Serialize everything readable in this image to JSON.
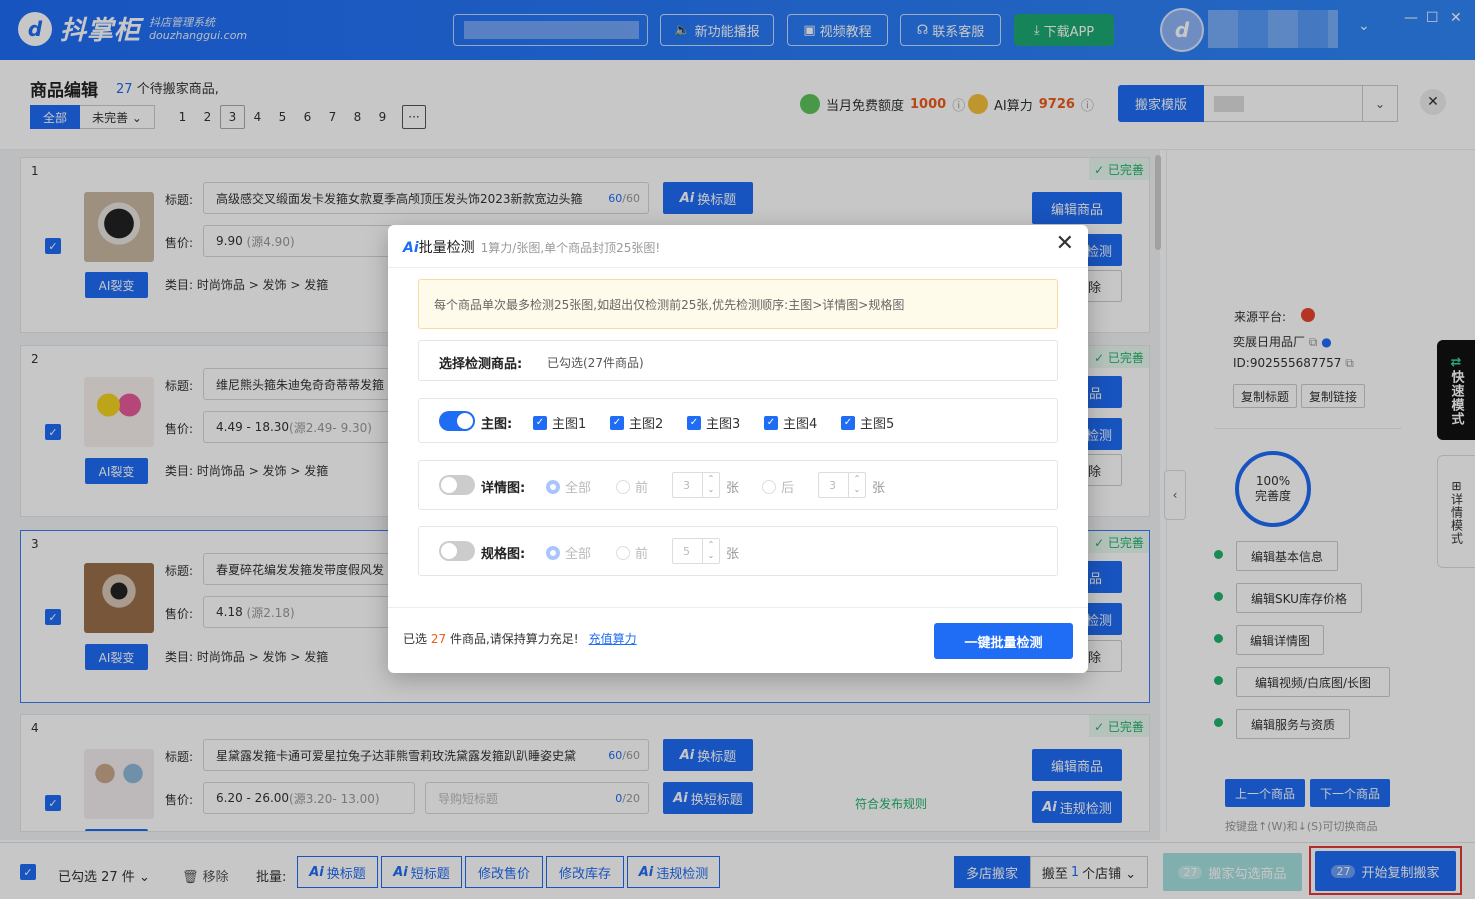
{
  "app": {
    "logo_mark": "d",
    "name": "抖掌柜",
    "subtitle_cn": "抖店管理系统",
    "subtitle_en": "douzhanggui.com"
  },
  "topbar": {
    "buttons": [
      {
        "label": "新功能播报",
        "icon": "megaphone-icon"
      },
      {
        "label": "视频教程",
        "icon": "video-icon"
      },
      {
        "label": "联系客服",
        "icon": "headset-icon"
      },
      {
        "label": "下载APP",
        "icon": "download-icon"
      }
    ],
    "avatar_mark": "d",
    "window": {
      "minimize": "—",
      "maximize": "☐",
      "close": "✕",
      "dropdown": "⌄"
    }
  },
  "header": {
    "title": "商品编辑",
    "count_num": "27",
    "count_text": "个待搬家商品,",
    "filter_all": "全部",
    "filter_incomplete": "未完善 ⌄",
    "pages": [
      "1",
      "2",
      "3",
      "4",
      "5",
      "6",
      "7",
      "8",
      "9"
    ],
    "current_page": "3",
    "more_pages": "···",
    "free_quota_label": "当月免费额度",
    "free_quota_value": "1000",
    "ai_power_label": "AI算力",
    "ai_power_value": "9726",
    "template_label": "搬家模版"
  },
  "products": [
    {
      "index": "1",
      "status": "✓ 已完善",
      "title_label": "标题:",
      "title": "高级感交叉缎面发卡发箍女款夏季高颅顶压发头饰2023新款宽边头箍",
      "title_count": "60",
      "title_max": "/60",
      "price_label": "售价:",
      "price": "9.90",
      "price_src": "(源4.90)",
      "category_label": "类目:",
      "category": "时尚饰品 > 发饰 > 发箍",
      "ai_split": "AI裂变",
      "ai_title": "换标题",
      "edit": "编辑商品",
      "check": "检测",
      "remove": "除"
    },
    {
      "index": "2",
      "status": "✓ 已完善",
      "title_label": "标题:",
      "title": "维尼熊头箍朱迪兔奇奇蒂蒂发箍",
      "price_label": "售价:",
      "price": "4.49 - 18.30",
      "price_src": "(源2.49- 9.30)",
      "category_label": "类目:",
      "category": "时尚饰品 > 发饰 > 发箍",
      "ai_split": "AI裂变",
      "edit": "品",
      "check": "检测",
      "remove": "除"
    },
    {
      "index": "3",
      "status": "✓ 已完善",
      "title_label": "标题:",
      "title": "春夏碎花编发发箍发带度假风发",
      "price_label": "售价:",
      "price": "4.18",
      "price_src": "(源2.18)",
      "category_label": "类目:",
      "category": "时尚饰品 > 发饰 > 发箍",
      "ai_split": "AI裂变",
      "edit": "品",
      "check": "检测",
      "remove": "除"
    },
    {
      "index": "4",
      "status": "✓ 已完善",
      "title_label": "标题:",
      "title": "星黛露发箍卡通可爱星拉兔子达菲熊雪莉玫洗黛露发箍趴趴睡姿史黛",
      "title_count": "60",
      "title_max": "/60",
      "price_label": "售价:",
      "price": "6.20 - 26.00",
      "price_src": "(源3.20- 13.00)",
      "short_title_placeholder": "导购短标题",
      "short_count": "0",
      "short_max": "/20",
      "ai_title": "换标题",
      "ai_short": "换短标题",
      "edit": "编辑商品",
      "check": "违规检测",
      "rule": "符合发布规则"
    }
  ],
  "side": {
    "source_label": "来源平台:",
    "shop": "奕展日用品厂",
    "id": "ID:902555687757",
    "copy_title": "复制标题",
    "copy_link": "复制链接",
    "completion": "100%",
    "completion_label": "完善度",
    "edit_items": [
      "编辑基本信息",
      "编辑SKU库存价格",
      "编辑详情图",
      "编辑视频/白底图/长图",
      "编辑服务与资质"
    ],
    "prev": "上一个商品",
    "next": "下一个商品",
    "hint": "按键盘↑(W)和↓(S)可切换商品",
    "mode_fast": "快速模式",
    "mode_detail": "详情模式"
  },
  "bottom": {
    "selected": "已勾选 27 件 ⌄",
    "remove": "移除",
    "batch": "批量:",
    "actions": [
      "换标题",
      "短标题",
      "修改售价",
      "修改库存",
      "违规检测"
    ],
    "multi_shop": "多店搬家",
    "move_to_prefix": "搬至",
    "move_to_num": "1",
    "move_to_suffix": "个店铺 ⌄",
    "move_selected_count": "27",
    "move_selected": "搬家勾选商品",
    "start_count": "27",
    "start": "开始复制搬家"
  },
  "dialog": {
    "ai": "Ai",
    "title": "批量检测",
    "subtitle": "1算力/张图,单个商品封顶25张图!",
    "tip": "每个商品单次最多检测25张图,如超出仅检测前25张,优先检测顺序:主图>详情图>规格图",
    "select_label": "选择检测商品:",
    "select_value": "已勾选(27件商品)",
    "main_label": "主图:",
    "main_items": [
      "主图1",
      "主图2",
      "主图3",
      "主图4",
      "主图5"
    ],
    "detail_label": "详情图:",
    "spec_label": "规格图:",
    "opt_all": "全部",
    "opt_first": "前",
    "opt_last": "后",
    "unit": "张",
    "step_val": "3",
    "step_val2": "3",
    "step_val3": "5",
    "foot_prefix": "已选",
    "foot_count": "27",
    "foot_suffix": "件商品,请保持算力充足!",
    "recharge": "充值算力",
    "confirm": "一键批量检测"
  }
}
